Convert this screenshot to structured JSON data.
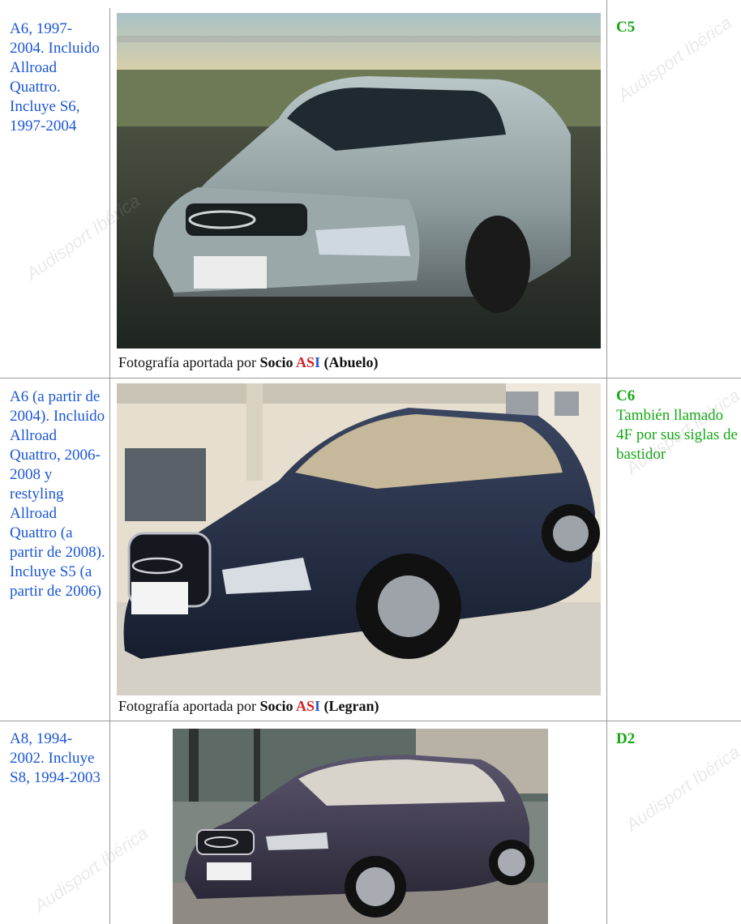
{
  "rows": [
    {
      "model": "A6, 1997-2004. Incluido Allroad Quattro. Incluye S6, 1997-2004",
      "generation_code": "C5",
      "generation_note": "",
      "photo_alt": "Audi A6 C5 plateado",
      "caption": {
        "prefix": "Fotografía aportada por ",
        "socio": "Socio ",
        "a": "A",
        "s": "S",
        "i": "I",
        "user": " (Abuelo)"
      }
    },
    {
      "model": "A6 (a partir de 2004). Incluido Allroad Quattro, 2006-2008 y restyling Allroad Quattro (a partir de 2008). Incluye S5 (a partir de 2006)",
      "generation_code": "C6",
      "generation_note": "También llamado 4F por sus siglas de bastidor",
      "photo_alt": "Audi A6 C6 azul oscuro",
      "caption": {
        "prefix": "Fotografía aportada por ",
        "socio": "Socio ",
        "a": "A",
        "s": "S",
        "i": "I",
        "user": " (Legran)"
      }
    },
    {
      "model": "A8, 1994-2002. Incluye S8, 1994-2003",
      "generation_code": "D2",
      "generation_note": "",
      "photo_alt": "Audi A8 D2 violeta oscuro"
    }
  ],
  "watermark": "Audisport Ibérica",
  "colors": {
    "model_link": "#1a56d6",
    "generation": "#13a813",
    "brand_red": "#d81f26",
    "brand_blue": "#2a5ad6",
    "border": "#999999"
  }
}
